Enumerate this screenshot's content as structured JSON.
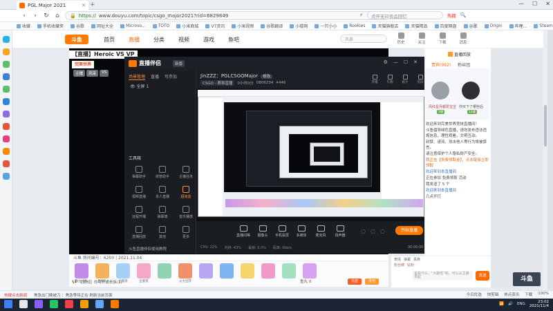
{
  "browser": {
    "tab_title": "PGL Major 2021",
    "url_scheme": "https://",
    "url": "www.douyu.com/topic/csgo_major2021?rid=6829849",
    "search_placeholder": "点开无印良品回忆",
    "hot_label": "热搜",
    "bookmarks": [
      "收藏",
      "手机收藏夹",
      "谷歌",
      "网址大全",
      "Microso...",
      "TOTO",
      "小米商城",
      "VT资讯",
      "小米视频",
      "谷歌翻译",
      "小楼网",
      "一只小小",
      "Rookies",
      "天猫旗舰店",
      "天猫精品",
      "百度网盘",
      "谷歌",
      "Origin",
      "哔哩...",
      "Steam",
      "https://...",
      "天猫精品",
      "打游戏",
      "游戏官网",
      "百度翻译",
      "哔哩哔哩",
      "百度盘"
    ],
    "status_news": "热搜点击新闻",
    "status_text": "焦急出门晚被刀 ：焦急等待正在 刷新当前页面",
    "status_right": [
      "今日优选",
      "快剪辑",
      "热点资讯",
      "下载",
      "100%"
    ]
  },
  "site": {
    "logo_text": "斗鱼",
    "nav": [
      "首页",
      "直播",
      "分类",
      "视频",
      "游戏",
      "鱼吧"
    ],
    "active_nav": "直播",
    "search_placeholder": "风暴",
    "user_icons": [
      "历史",
      "关注",
      "下载",
      "消息"
    ]
  },
  "stream": {
    "title": "【直播】Heroic VS VP",
    "badge": "完美世界",
    "room_tags": [
      "主播",
      "风采",
      "VS"
    ],
    "room_footer": "斗鱼 房间编号：6200 | 2021.11.04",
    "gifts": [
      {
        "label": "粉丝大礼",
        "color": "#c48aea"
      },
      {
        "label": "直播礼",
        "color": "#f3b25c"
      },
      {
        "label": "全套装",
        "color": "#a6d0f7"
      },
      {
        "label": "全套装",
        "color": "#f4a8c6"
      },
      {
        "label": "",
        "color": "#8fd4b3"
      },
      {
        "label": "火力全开",
        "color": "#f38f6b"
      },
      {
        "label": "",
        "color": "#b7a7f2"
      },
      {
        "label": "",
        "color": "#7eb5f0"
      },
      {
        "label": "",
        "color": "#f7d36b"
      },
      {
        "label": "",
        "color": "#ef9ac9"
      },
      {
        "label": "",
        "color": "#a3e0c2"
      },
      {
        "label": "",
        "color": "#d6a2f2"
      }
    ],
    "danmu_placeholder": "【通知】你可开通贵族(1)",
    "fish_ball": "鱼丸 0",
    "recharge_label": "充值",
    "bag_label": "背包"
  },
  "companion": {
    "app_name": "直播伴侣",
    "version": "新版",
    "left_tabs": [
      "场景管理",
      "直播",
      "可参加"
    ],
    "active_left_tab": "场景管理",
    "scenes_label": "全屏 1",
    "tools_label": "工具箱",
    "tools": [
      {
        "label": "弹幕助手"
      },
      {
        "label": "房管助手"
      },
      {
        "label": "主播任务"
      },
      {
        "label": "视频直播"
      },
      {
        "label": "本人直播"
      },
      {
        "label": "超级盒",
        "hot": true
      },
      {
        "label": "远程开播"
      },
      {
        "label": "弹幕墙"
      },
      {
        "label": "音乐播放"
      },
      {
        "label": "直播回放"
      },
      {
        "label": "其他"
      },
      {
        "label": "更多"
      }
    ],
    "footer": "斗鱼直播伴侣使用教程",
    "streamer": "JinZZZ：PGLCSGOMajor",
    "live_tag": "修改",
    "category": "CSGO - 赛事直播",
    "stat1": "0小时0分",
    "stat2": "0806234",
    "stat3": "4446",
    "right_icons": [
      "开播",
      "礼物",
      "统计",
      "房间",
      "粉丝",
      "分享"
    ],
    "controls": [
      "直播间等",
      "摄像头",
      "手机投屏",
      "多媒体",
      "麦克风",
      "扬声器"
    ],
    "start_button": "开始直播",
    "status_items": [
      "CPU: 12%",
      "内存: 43%",
      "丢帧: 0.0%",
      "码率: 0kb/s"
    ],
    "timer": "00:00:00"
  },
  "chat": {
    "title": "直播回放",
    "tabs": [
      "贵宾(992)",
      "粉丝团"
    ],
    "active_tab": "贵宾(992)",
    "rank_name1": "风红星月都爱宝宝",
    "rank_name2": "你买下了哪些后",
    "rank_level1": "1级",
    "rank_level2": "12级",
    "messages": [
      {
        "text": "欢迎来到完美世界竞技直播间！",
        "cls": ""
      },
      {
        "text": "斗鱼倡导绿色直播，请勿发布违法违规信息，理性观看，文明互动。",
        "cls": ""
      },
      {
        "text": "封禁、谩骂、攻击他人等行为将被禁言。",
        "cls": ""
      },
      {
        "text": "请注意保护个人隐私财产安全。",
        "cls": ""
      },
      {
        "text": "我正在【免费领取金】，点击链接立即领取",
        "cls": "hl"
      },
      {
        "text": "欢迎来到本直播间",
        "cls": "blue"
      },
      {
        "text": "正在参加 免费领取 活动",
        "cls": ""
      },
      {
        "text": "我发送了 5 个",
        "cls": ""
      },
      {
        "text": "欢迎来到本直播间",
        "cls": "blue"
      },
      {
        "text": "几点开打",
        "cls": ""
      }
    ],
    "row1": [
      "表情",
      "弹幕",
      "贵族"
    ],
    "row2": [
      "粉丝牌",
      "钻粉"
    ],
    "input_placeholder": "说些什么，\"大聊性\"吧，可以从主播发起",
    "send_label": "发送"
  },
  "brand_corner": "斗鱼",
  "taskbar": {
    "tray": [
      "ENG"
    ],
    "time": "23:02",
    "date": "2021/11/4"
  }
}
